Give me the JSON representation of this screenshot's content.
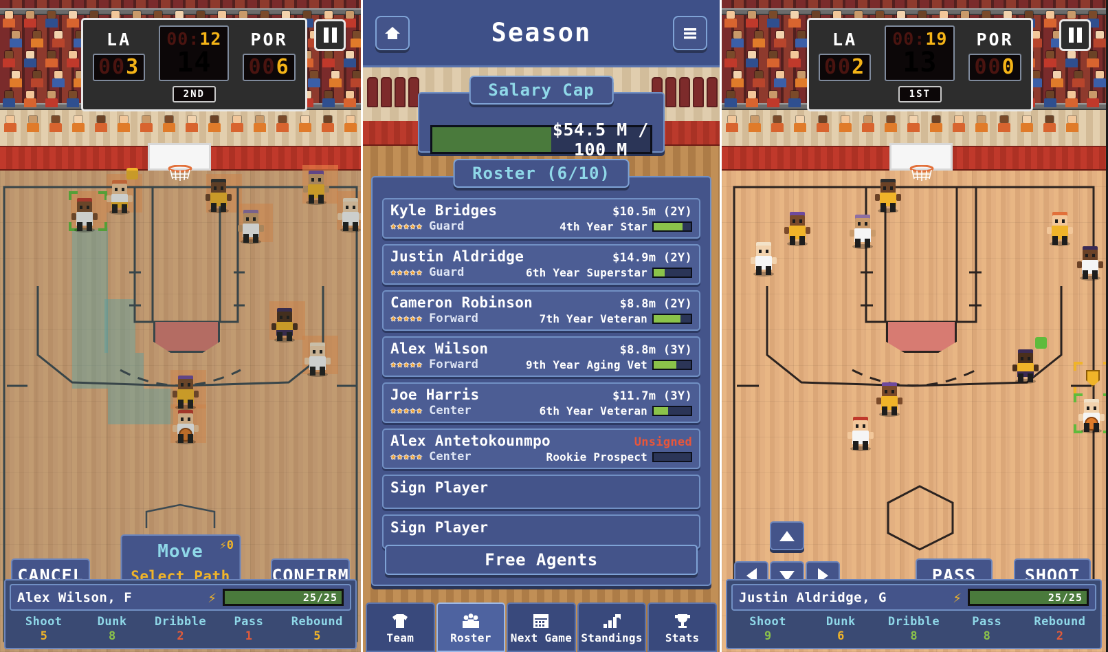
{
  "left_game": {
    "scoreboard": {
      "home_abbr": "LA",
      "home_score": "3",
      "home_score_pad": "00",
      "away_abbr": "POR",
      "away_score": "6",
      "away_score_pad": "00",
      "clock": "12",
      "clock_pad": "00:",
      "shot_clock": "14",
      "period": "2ND"
    },
    "pause_icon": "pause-icon",
    "action_card": {
      "title": "Move",
      "cost": "0",
      "subtitle": "Select Path"
    },
    "cancel_label": "CANCEL",
    "confirm_label": "CONFIRM",
    "hud": {
      "player_name": "Alex Wilson, F",
      "energy": "25/25",
      "energy_pct": 100,
      "stats": [
        {
          "label": "Shoot",
          "value": "5",
          "tone": "gold"
        },
        {
          "label": "Dunk",
          "value": "8",
          "tone": "green"
        },
        {
          "label": "Dribble",
          "value": "2",
          "tone": "red"
        },
        {
          "label": "Pass",
          "value": "1",
          "tone": "red"
        },
        {
          "label": "Rebound",
          "value": "5",
          "tone": "gold"
        }
      ]
    }
  },
  "season": {
    "title": "Season",
    "home_icon": "home-icon",
    "menu_icon": "hamburger-menu-icon",
    "salary_cap": {
      "tab_label": "Salary Cap",
      "value_text": "$54.5 M / 100 M",
      "fill_pct": 54.5
    },
    "roster": {
      "tab_label": "Roster (6/10)",
      "players": [
        {
          "name": "Kyle Bridges",
          "salary": "$10.5m (2Y)",
          "stars": "★★★★★",
          "position": "Guard",
          "experience": "4th Year Star",
          "bar_pct": 78,
          "unsigned": false
        },
        {
          "name": "Justin Aldridge",
          "salary": "$14.9m (2Y)",
          "stars": "★★★★★",
          "position": "Guard",
          "experience": "6th Year Superstar",
          "bar_pct": 30,
          "unsigned": false
        },
        {
          "name": "Cameron Robinson",
          "salary": "$8.8m (2Y)",
          "stars": "★★★★★",
          "position": "Forward",
          "experience": "7th Year Veteran",
          "bar_pct": 72,
          "unsigned": false
        },
        {
          "name": "Alex Wilson",
          "salary": "$8.8m (3Y)",
          "stars": "★★★★★",
          "position": "Forward",
          "experience": "9th Year Aging Vet",
          "bar_pct": 62,
          "unsigned": false
        },
        {
          "name": "Joe Harris",
          "salary": "$11.7m (3Y)",
          "stars": "★★★★★",
          "position": "Center",
          "experience": "6th Year Veteran",
          "bar_pct": 38,
          "unsigned": false
        },
        {
          "name": "Alex Antetokounmpo",
          "salary": "Unsigned",
          "stars": "★★★★★",
          "position": "Center",
          "experience": "Rookie Prospect",
          "bar_pct": 0,
          "unsigned": true
        }
      ],
      "empty_slots": [
        "Sign Player",
        "Sign Player"
      ],
      "free_agents_label": "Free Agents"
    },
    "nav": [
      {
        "label": "Team",
        "icon": "jersey-icon",
        "active": false
      },
      {
        "label": "Roster",
        "icon": "people-group-icon",
        "active": true
      },
      {
        "label": "Next Game",
        "icon": "calendar-icon",
        "active": false
      },
      {
        "label": "Standings",
        "icon": "bar-chart-arrow-icon",
        "active": false
      },
      {
        "label": "Stats",
        "icon": "trophy-icon",
        "active": false
      }
    ]
  },
  "right_game": {
    "scoreboard": {
      "home_abbr": "LA",
      "home_score": "2",
      "home_score_pad": "00",
      "away_abbr": "POR",
      "away_score": "0",
      "away_score_pad": "00",
      "clock": "19",
      "clock_pad": "00:",
      "shot_clock": "13",
      "period": "1ST"
    },
    "pause_icon": "pause-icon",
    "dpad": {
      "up": "up-arrow-icon",
      "down": "down-arrow-icon",
      "left": "left-arrow-icon",
      "right": "right-arrow-icon"
    },
    "pass_label": "PASS",
    "shoot_label": "SHOOT",
    "hud": {
      "player_name": "Justin Aldridge, G",
      "energy": "25/25",
      "energy_pct": 100,
      "stats": [
        {
          "label": "Shoot",
          "value": "9",
          "tone": "green"
        },
        {
          "label": "Dunk",
          "value": "6",
          "tone": "gold"
        },
        {
          "label": "Dribble",
          "value": "8",
          "tone": "green"
        },
        {
          "label": "Pass",
          "value": "8",
          "tone": "green"
        },
        {
          "label": "Rebound",
          "value": "2",
          "tone": "red"
        }
      ]
    }
  },
  "colors": {
    "panel_blue": "#44548a",
    "accent_cyan": "#8fd8e8",
    "accent_gold": "#f0b429",
    "danger_red": "#e8563a",
    "bar_green": "#8bc34a",
    "court_wood": "#e8b684"
  }
}
